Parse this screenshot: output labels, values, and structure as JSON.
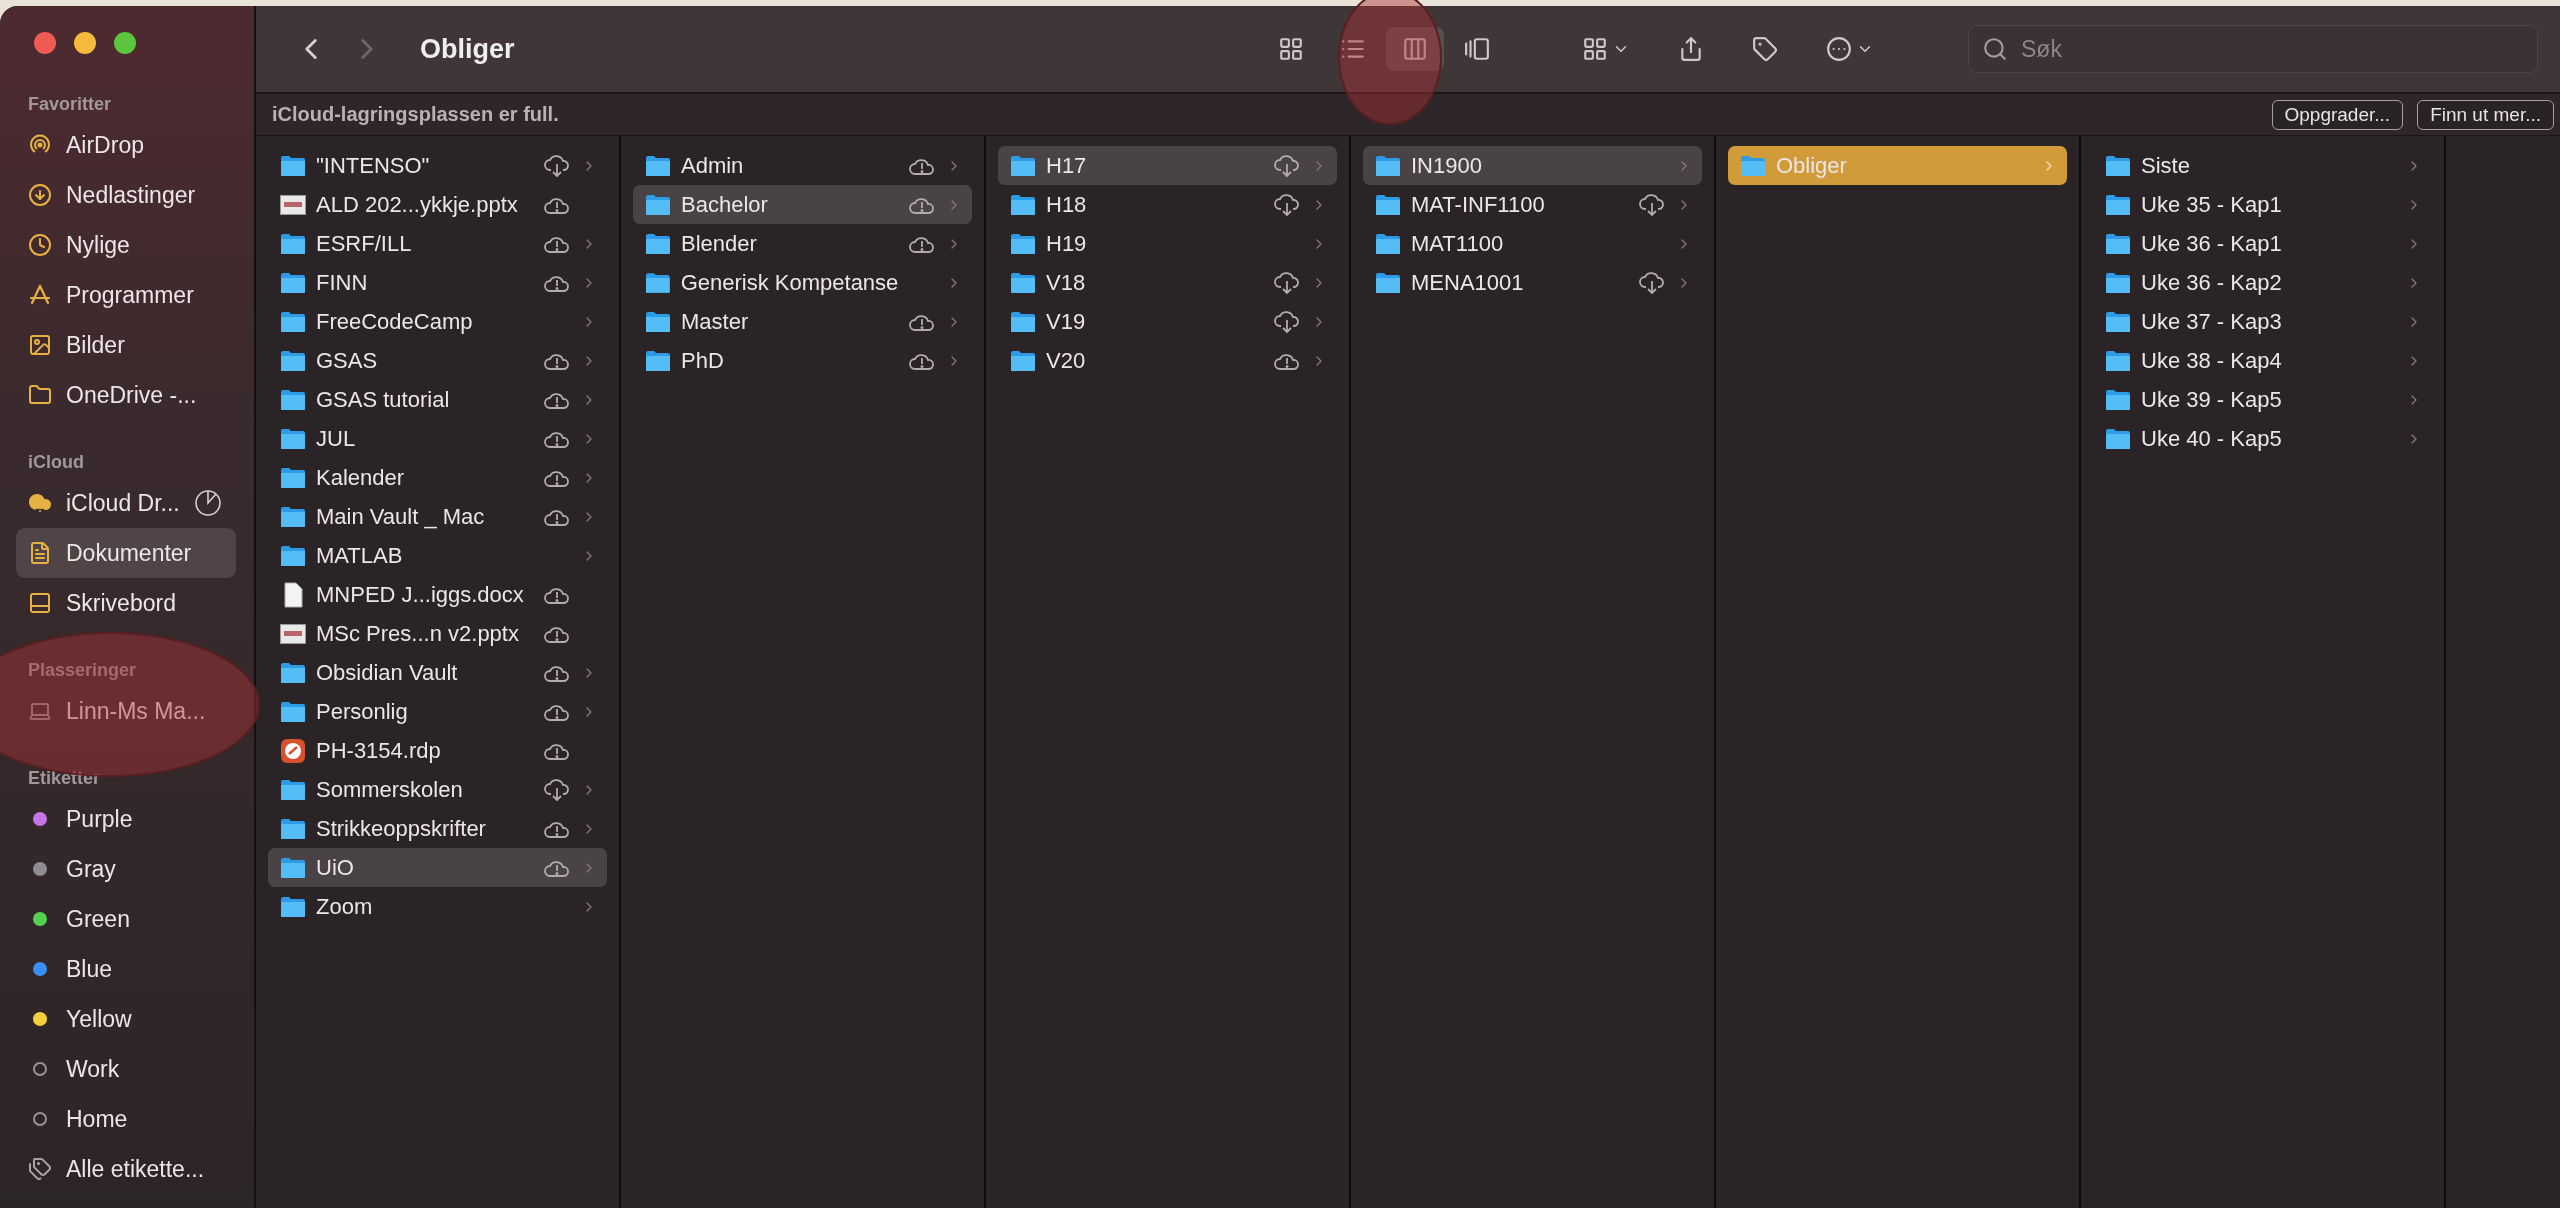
{
  "window": {
    "title": "Obliger"
  },
  "sidebar": {
    "sections": [
      {
        "header": "Favoritter",
        "items": [
          {
            "label": "AirDrop",
            "kind": "airdrop",
            "selected": false
          },
          {
            "label": "Nedlastinger",
            "kind": "download",
            "selected": false
          },
          {
            "label": "Nylige",
            "kind": "clock",
            "selected": false
          },
          {
            "label": "Programmer",
            "kind": "apps",
            "selected": false
          },
          {
            "label": "Bilder",
            "kind": "photo",
            "selected": false
          },
          {
            "label": "OneDrive -...",
            "kind": "folder",
            "selected": false
          }
        ]
      },
      {
        "header": "iCloud",
        "items": [
          {
            "label": "iCloud Dr...",
            "kind": "icloud",
            "selected": false
          },
          {
            "label": "Dokumenter",
            "kind": "document",
            "selected": true
          },
          {
            "label": "Skrivebord",
            "kind": "desktop",
            "selected": false
          }
        ]
      },
      {
        "header": "Plasseringer",
        "items": [
          {
            "label": "Linn-Ms Ma...",
            "kind": "laptop",
            "selected": false
          }
        ]
      },
      {
        "header": "Etiketter",
        "items": [
          {
            "label": "Purple",
            "kind": "tag",
            "color": "#c476e8",
            "selected": false
          },
          {
            "label": "Gray",
            "kind": "tag",
            "color": "#8d8c91",
            "selected": false
          },
          {
            "label": "Green",
            "kind": "tag",
            "color": "#52d04e",
            "selected": false
          },
          {
            "label": "Blue",
            "kind": "tag",
            "color": "#3a8ff2",
            "selected": false
          },
          {
            "label": "Yellow",
            "kind": "tag",
            "color": "#f6cf3c",
            "selected": false
          },
          {
            "label": "Work",
            "kind": "tag-empty",
            "selected": false
          },
          {
            "label": "Home",
            "kind": "tag-empty",
            "selected": false
          },
          {
            "label": "Alle etikette...",
            "kind": "tags-all",
            "selected": false
          }
        ]
      }
    ]
  },
  "toolbar": {
    "views": [
      {
        "kind": "icons",
        "selected": false
      },
      {
        "kind": "list",
        "selected": false
      },
      {
        "kind": "columns",
        "selected": true
      },
      {
        "kind": "gallery",
        "selected": false
      }
    ],
    "search": {
      "placeholder": "Søk"
    }
  },
  "banner": {
    "message": "iCloud-lagringsplassen er full.",
    "buttons": [
      "Oppgrader...",
      "Finn ut mer..."
    ]
  },
  "columns": [
    {
      "items": [
        {
          "name": "\"INTENSO\"",
          "kind": "folder",
          "cloud_download": true,
          "cloud_alert": false,
          "selected": false
        },
        {
          "name": "ALD 202...ykkje.pptx",
          "kind": "slides",
          "cloud_download": false,
          "cloud_alert": true,
          "selected": false
        },
        {
          "name": "ESRF/ILL",
          "kind": "folder",
          "cloud_download": false,
          "cloud_alert": true,
          "selected": false
        },
        {
          "name": "FINN",
          "kind": "folder",
          "cloud_download": false,
          "cloud_alert": true,
          "selected": false
        },
        {
          "name": "FreeCodeCamp",
          "kind": "folder",
          "cloud_download": false,
          "cloud_alert": false,
          "selected": false
        },
        {
          "name": "GSAS",
          "kind": "folder",
          "cloud_download": false,
          "cloud_alert": true,
          "selected": false
        },
        {
          "name": "GSAS tutorial",
          "kind": "folder",
          "cloud_download": false,
          "cloud_alert": true,
          "selected": false
        },
        {
          "name": "JUL",
          "kind": "folder",
          "cloud_download": false,
          "cloud_alert": true,
          "selected": false
        },
        {
          "name": "Kalender",
          "kind": "folder",
          "cloud_download": false,
          "cloud_alert": true,
          "selected": false
        },
        {
          "name": "Main Vault _ Mac",
          "kind": "folder",
          "cloud_download": false,
          "cloud_alert": true,
          "selected": false
        },
        {
          "name": "MATLAB",
          "kind": "folder",
          "cloud_download": false,
          "cloud_alert": false,
          "selected": false
        },
        {
          "name": "MNPED J...iggs.docx",
          "kind": "document",
          "cloud_download": false,
          "cloud_alert": true,
          "selected": false
        },
        {
          "name": "MSc Pres...n v2.pptx",
          "kind": "slides",
          "cloud_download": false,
          "cloud_alert": true,
          "selected": false
        },
        {
          "name": "Obsidian Vault",
          "kind": "folder",
          "cloud_download": false,
          "cloud_alert": true,
          "selected": false
        },
        {
          "name": "Personlig",
          "kind": "folder",
          "cloud_download": false,
          "cloud_alert": true,
          "selected": false
        },
        {
          "name": "PH-3154.rdp",
          "kind": "remote",
          "cloud_download": false,
          "cloud_alert": true,
          "selected": false
        },
        {
          "name": "Sommerskolen",
          "kind": "folder",
          "cloud_download": true,
          "cloud_alert": false,
          "selected": false
        },
        {
          "name": "Strikkeoppskrifter",
          "kind": "folder",
          "cloud_download": false,
          "cloud_alert": true,
          "selected": false
        },
        {
          "name": "UiO",
          "kind": "folder",
          "cloud_download": false,
          "cloud_alert": true,
          "selected": true
        },
        {
          "name": "Zoom",
          "kind": "folder",
          "cloud_download": false,
          "cloud_alert": false,
          "selected": false
        }
      ]
    },
    {
      "items": [
        {
          "name": "Admin",
          "kind": "folder",
          "cloud_download": false,
          "cloud_alert": true,
          "selected": false
        },
        {
          "name": "Bachelor",
          "kind": "folder",
          "cloud_download": false,
          "cloud_alert": true,
          "selected": true
        },
        {
          "name": "Blender",
          "kind": "folder",
          "cloud_download": false,
          "cloud_alert": true,
          "selected": false
        },
        {
          "name": "Generisk Kompetanse",
          "kind": "folder",
          "cloud_download": false,
          "cloud_alert": false,
          "selected": false
        },
        {
          "name": "Master",
          "kind": "folder",
          "cloud_download": false,
          "cloud_alert": true,
          "selected": false
        },
        {
          "name": "PhD",
          "kind": "folder",
          "cloud_download": false,
          "cloud_alert": true,
          "selected": false
        }
      ]
    },
    {
      "items": [
        {
          "name": "H17",
          "kind": "folder",
          "cloud_download": true,
          "cloud_alert": false,
          "selected": true
        },
        {
          "name": "H18",
          "kind": "folder",
          "cloud_download": true,
          "cloud_alert": false,
          "selected": false
        },
        {
          "name": "H19",
          "kind": "folder",
          "cloud_download": false,
          "cloud_alert": false,
          "selected": false
        },
        {
          "name": "V18",
          "kind": "folder",
          "cloud_download": true,
          "cloud_alert": false,
          "selected": false
        },
        {
          "name": "V19",
          "kind": "folder",
          "cloud_download": true,
          "cloud_alert": false,
          "selected": false
        },
        {
          "name": "V20",
          "kind": "folder",
          "cloud_download": false,
          "cloud_alert": true,
          "selected": false
        }
      ]
    },
    {
      "items": [
        {
          "name": "IN1900",
          "kind": "folder",
          "cloud_download": false,
          "cloud_alert": false,
          "selected": true
        },
        {
          "name": "MAT-INF1100",
          "kind": "folder",
          "cloud_download": true,
          "cloud_alert": false,
          "selected": false
        },
        {
          "name": "MAT1100",
          "kind": "folder",
          "cloud_download": false,
          "cloud_alert": false,
          "selected": false
        },
        {
          "name": "MENA1001",
          "kind": "folder",
          "cloud_download": true,
          "cloud_alert": false,
          "selected": false
        }
      ]
    },
    {
      "active": true,
      "items": [
        {
          "name": "Obliger",
          "kind": "folder",
          "cloud_download": false,
          "cloud_alert": false,
          "selected": true
        }
      ]
    },
    {
      "items": [
        {
          "name": "Siste",
          "kind": "folder",
          "cloud_download": false,
          "cloud_alert": false,
          "selected": false
        },
        {
          "name": "Uke 35 - Kap1",
          "kind": "folder",
          "cloud_download": false,
          "cloud_alert": false,
          "selected": false
        },
        {
          "name": "Uke 36 - Kap1",
          "kind": "folder",
          "cloud_download": false,
          "cloud_alert": false,
          "selected": false
        },
        {
          "name": "Uke 36 - Kap2",
          "kind": "folder",
          "cloud_download": false,
          "cloud_alert": false,
          "selected": false
        },
        {
          "name": "Uke 37 - Kap3",
          "kind": "folder",
          "cloud_download": false,
          "cloud_alert": false,
          "selected": false
        },
        {
          "name": "Uke 38 - Kap4",
          "kind": "folder",
          "cloud_download": false,
          "cloud_alert": false,
          "selected": false
        },
        {
          "name": "Uke 39 - Kap5",
          "kind": "folder",
          "cloud_download": false,
          "cloud_alert": false,
          "selected": false
        },
        {
          "name": "Uke 40 - Kap5",
          "kind": "folder",
          "cloud_download": false,
          "cloud_alert": false,
          "selected": false
        }
      ]
    }
  ]
}
